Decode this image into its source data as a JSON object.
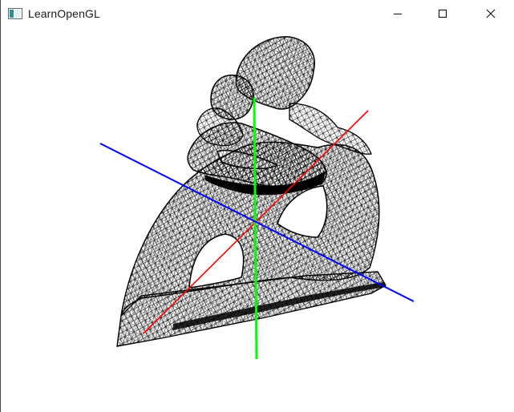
{
  "window": {
    "title": "LearnOpenGL",
    "icon": "app-window-icon",
    "controls": {
      "minimize_icon": "minimize-icon",
      "maximize_icon": "maximize-icon",
      "close_icon": "close-icon"
    }
  },
  "scene": {
    "background": "#ffffff",
    "model_color": "#000000",
    "axes": {
      "x_color": "#ff0000",
      "y_color": "#00ff00",
      "z_color": "#0000ff"
    }
  }
}
